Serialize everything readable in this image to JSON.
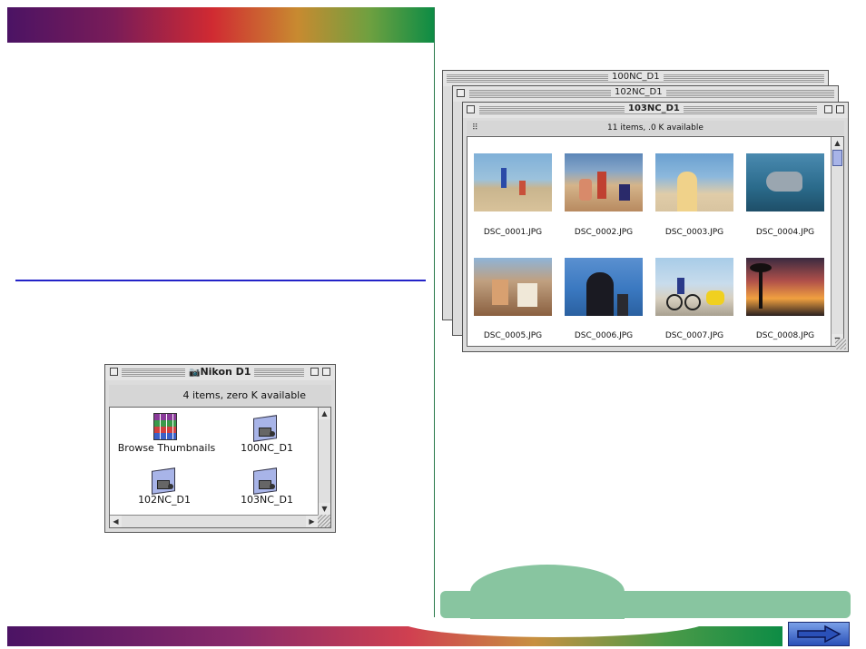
{
  "thumbs_window": {
    "back_title_1": "100NC_D1",
    "back_title_2": "102NC_D1",
    "front_title": "103NC_D1",
    "info": "11 items, .0 K available",
    "items": [
      {
        "name": "DSC_0001.JPG"
      },
      {
        "name": "DSC_0002.JPG"
      },
      {
        "name": "DSC_0003.JPG"
      },
      {
        "name": "DSC_0004.JPG"
      },
      {
        "name": "DSC_0005.JPG"
      },
      {
        "name": "DSC_0006.JPG"
      },
      {
        "name": "DSC_0007.JPG"
      },
      {
        "name": "DSC_0008.JPG"
      }
    ]
  },
  "nikon_window": {
    "title": "Nikon D1",
    "info": "4 items, zero K available",
    "items": [
      {
        "label": "Browse Thumbnails",
        "icon": "grid-app-icon"
      },
      {
        "label": "100NC_D1",
        "icon": "folder-icon"
      },
      {
        "label": "102NC_D1",
        "icon": "folder-icon"
      },
      {
        "label": "103NC_D1",
        "icon": "folder-icon"
      }
    ]
  },
  "colors": {
    "accent_green": "#88c5a0",
    "rule_blue": "#2323c8",
    "divider_green": "#2a7a4a"
  },
  "icons": {
    "next": "right-arrow-icon"
  }
}
